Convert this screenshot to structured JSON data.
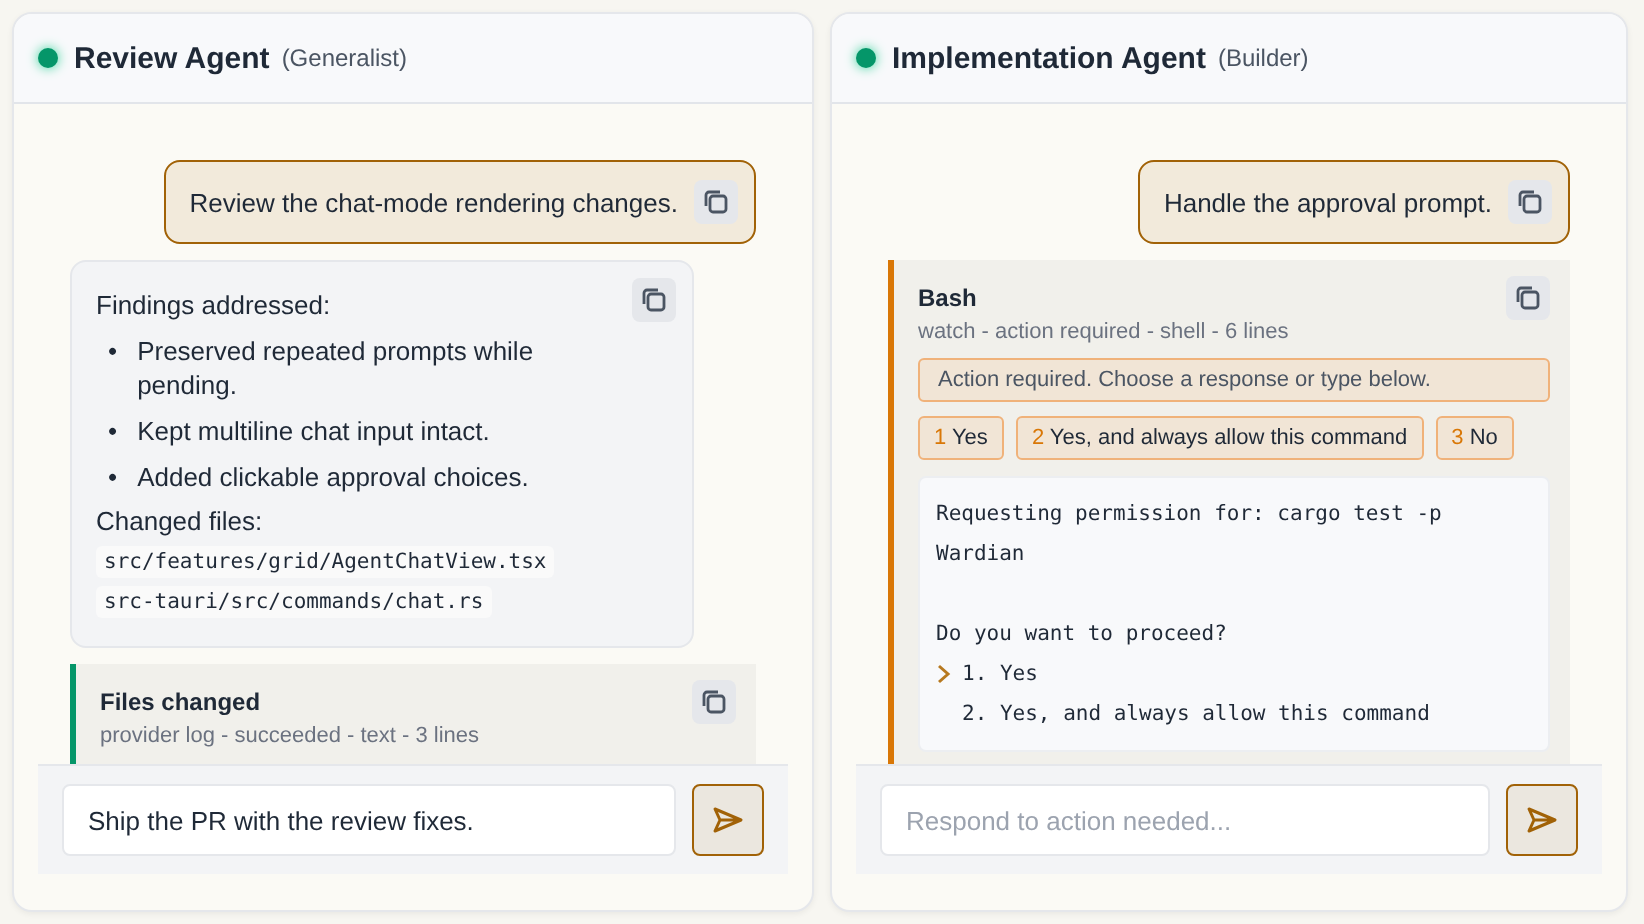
{
  "panels": [
    {
      "title": "Review Agent",
      "role": "(Generalist)",
      "online": true,
      "messages": [
        {
          "kind": "user",
          "text": "Review the chat-mode rendering changes."
        },
        {
          "kind": "assistant",
          "intro": "Findings addressed:",
          "marker": "•",
          "bullets": [
            "Preserved repeated prompts while pending.",
            "Kept multiline chat input intact.",
            "Added clickable approval choices."
          ],
          "files_label": "Changed files:",
          "files": [
            "src/features/grid/AgentChatView.tsx",
            "src-tauri/src/commands/chat.rs"
          ]
        },
        {
          "kind": "tool",
          "title": "Files changed",
          "meta": "provider log - succeeded - text - 3 lines",
          "color": "#059669"
        }
      ],
      "composer": {
        "value": "Ship the PR with the review fixes."
      }
    },
    {
      "title": "Implementation Agent",
      "role": "(Builder)",
      "online": true,
      "messages": [
        {
          "kind": "user",
          "text": "Handle the approval prompt."
        },
        {
          "kind": "tool",
          "title": "Bash",
          "meta": "watch - action required - shell - 6 lines",
          "color": "#d97706",
          "notice": "Action required. Choose a response or type below.",
          "choices": [
            {
              "key": "1",
              "label": "Yes"
            },
            {
              "key": "2",
              "label": "Yes, and always allow this command"
            },
            {
              "key": "3",
              "label": "No"
            }
          ],
          "output": [
            {
              "kind": "text",
              "text": "Requesting permission for: cargo test -p Wardian"
            },
            {
              "kind": "blank"
            },
            {
              "kind": "text",
              "text": "Do you want to proceed?"
            },
            {
              "kind": "option",
              "text": "1. Yes",
              "selected": true
            },
            {
              "kind": "option",
              "text": "2. Yes, and always allow this command",
              "selected": false
            }
          ]
        }
      ],
      "composer": {
        "placeholder": "Respond to action needed..."
      }
    }
  ]
}
